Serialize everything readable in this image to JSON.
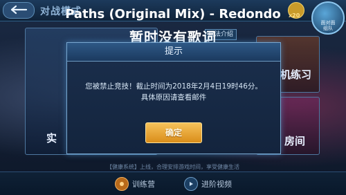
{
  "topbar": {
    "mode_title": "对战模式",
    "coin_count": "x20",
    "avatar_label": "面对面\n组队"
  },
  "overlay": {
    "song_title": "Paths (Original Mix) - Redondo",
    "lyrics": "暂时没有歌词"
  },
  "background": {
    "tag_chip": "玩法介绍",
    "right_top_label": "机练习",
    "right_bottom_label": "房间",
    "left_label": "实"
  },
  "dialog": {
    "title": "提示",
    "message_line1": "您被禁止竞技！截止时间为2018年2月4日19时46分。",
    "message_line2": "具体原因请查看邮件",
    "confirm_label": "确定"
  },
  "footer": {
    "notice": "【健康系统】上线，合理安排游戏时间，享受健康生活",
    "camp_label": "训练营",
    "video_label": "进阶视频"
  },
  "colors": {
    "dialog_border": "#79a7cf",
    "confirm_button": "#e8a636"
  },
  "icons": {
    "back": "back-arrow-icon",
    "camp": "training-camp-icon",
    "video": "play-video-icon"
  }
}
